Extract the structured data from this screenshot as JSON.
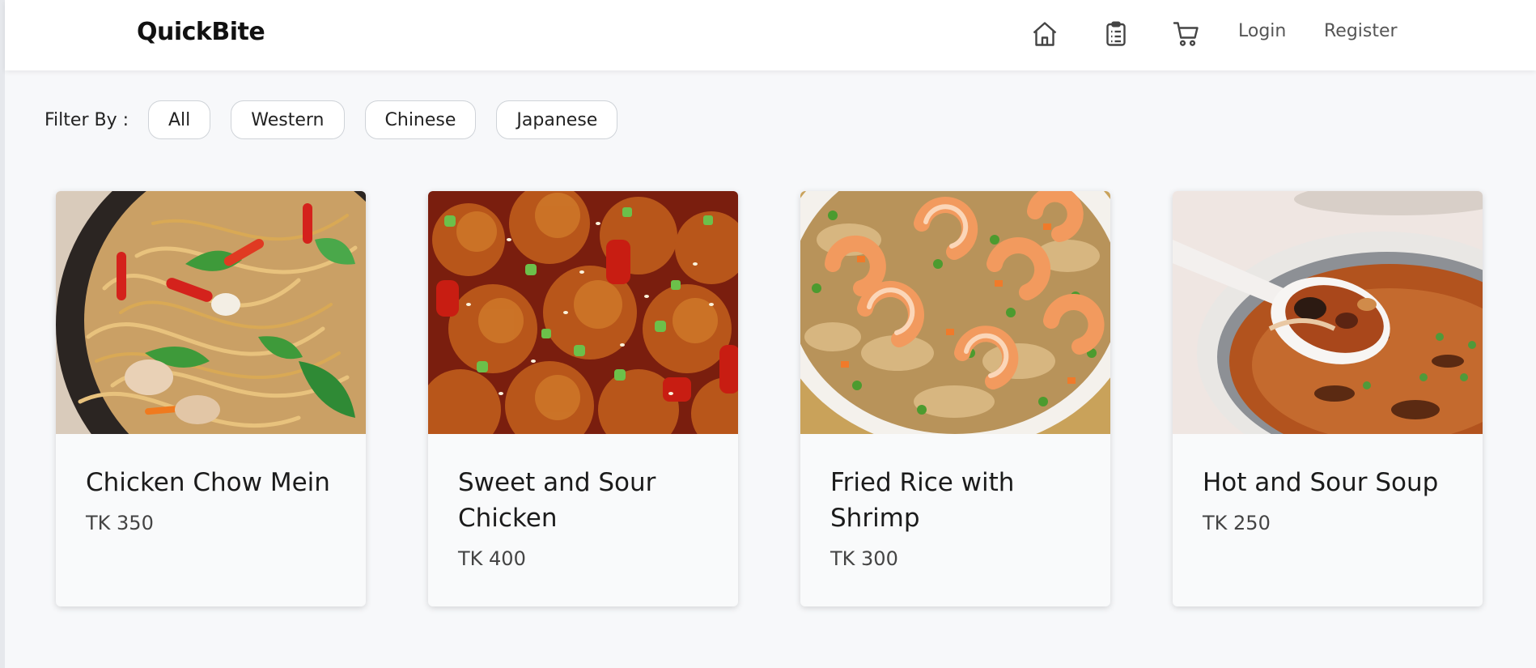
{
  "header": {
    "brand": "QuickBite",
    "login_label": "Login",
    "register_label": "Register",
    "icons": [
      "home-icon",
      "clipboard-icon",
      "cart-icon"
    ]
  },
  "filter": {
    "label": "Filter By :",
    "options": [
      "All",
      "Western",
      "Chinese",
      "Japanese"
    ]
  },
  "items": [
    {
      "name": "Chicken Chow Mein",
      "price": "TK 350",
      "image": "noodles-dish"
    },
    {
      "name": "Sweet and Sour Chicken",
      "price": "TK 400",
      "image": "sweet-sour-chicken-dish"
    },
    {
      "name": "Fried Rice with Shrimp",
      "price": "TK 300",
      "image": "shrimp-fried-rice-dish"
    },
    {
      "name": "Hot and Sour Soup",
      "price": "TK 250",
      "image": "soup-dish"
    }
  ],
  "colors": {
    "background": "#f7f8fa",
    "navbar": "#ffffff",
    "text": "#222222",
    "muted": "#555555"
  }
}
